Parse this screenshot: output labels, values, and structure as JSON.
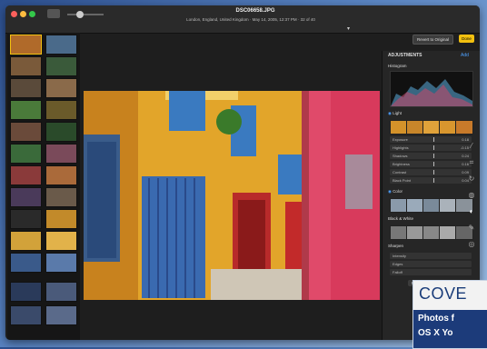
{
  "window": {
    "title": "DSC06658.JPG",
    "subtitle": "London, England, United Kingdom · May 14, 2005, 12:37 PM · 32 of 40"
  },
  "toolbar": {
    "zoom_label": "",
    "revert_label": "Revert to Original",
    "done_label": "Done"
  },
  "panel": {
    "title": "ADJUSTMENTS",
    "add_label": "Add",
    "histogram_label": "Histogram",
    "light_label": "Light",
    "light_rows": [
      {
        "label": "Exposure",
        "value": "0.18"
      },
      {
        "label": "Highlights",
        "value": "-0.15"
      },
      {
        "label": "Shadows",
        "value": "0.24"
      },
      {
        "label": "Brightness",
        "value": "0.16"
      },
      {
        "label": "Contrast",
        "value": "0.09"
      },
      {
        "label": "Black Point",
        "value": "0.04"
      }
    ],
    "color_label": "Color",
    "bw_label": "Black & White",
    "sharpen_label": "Sharpen",
    "sharpen_rows": [
      {
        "label": "Intensity",
        "value": ""
      },
      {
        "label": "Edges",
        "value": ""
      },
      {
        "label": "Falloff",
        "value": ""
      }
    ],
    "reset_label": "Reset"
  },
  "cover": {
    "heading": "COVE",
    "line1": "Photos f",
    "line2": "OS X Yo"
  },
  "colors": {
    "accent": "#f2c00f",
    "link": "#4ea1ff",
    "cover_blue": "#1c3b7a"
  }
}
